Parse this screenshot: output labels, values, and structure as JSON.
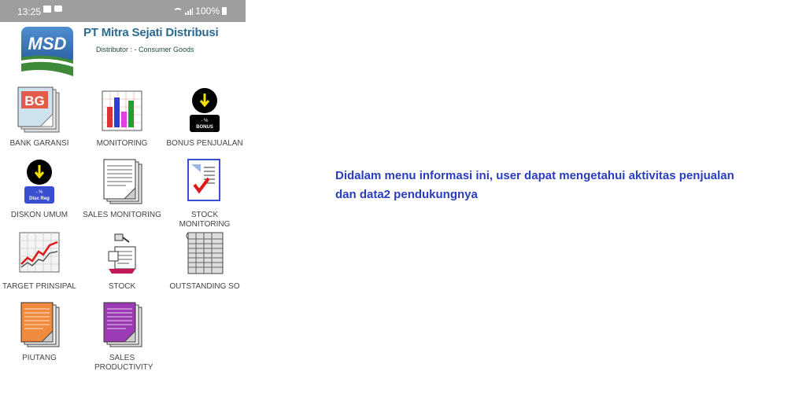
{
  "status_bar": {
    "time": "13:25",
    "battery": "100%"
  },
  "header": {
    "logo_text": "MSD",
    "company_name": "PT Mitra Sejati Distribusi",
    "subtitle": "Distributor : - Consumer Goods"
  },
  "menu": {
    "bank_garansi": {
      "label": "BANK GARANSI",
      "icon_text": "BG"
    },
    "monitoring": {
      "label": "MONITORING"
    },
    "bonus_penjualan": {
      "label": "BONUS PENJUALAN",
      "badge_top": "- %",
      "badge_bottom": "BONUS"
    },
    "diskon_umum": {
      "label": "DISKON UMUM",
      "badge_top": "- %",
      "badge_bottom": "Disc Reg"
    },
    "sales_monitoring": {
      "label": "SALES MONITORING"
    },
    "stock_monitoring": {
      "label": "STOCK MONITORING"
    },
    "target_prinsipal": {
      "label": "TARGET PRINSIPAL"
    },
    "stock": {
      "label": "STOCK"
    },
    "outstanding_so": {
      "label": "OUTSTANDING SO"
    },
    "piutang": {
      "label": "PIUTANG"
    },
    "sales_productivity": {
      "label": "SALES PRODUCTIVITY"
    }
  },
  "info_text": "Didalam menu informasi ini, user dapat mengetahui aktivitas penjualan dan data2 pendukungnya",
  "colors": {
    "status_bar": "#9e9e9e",
    "company_name": "#2a6a8f",
    "info_text": "#2a3dbd",
    "logo_blue": "#2f6aa8",
    "logo_green": "#3f8a3a"
  }
}
